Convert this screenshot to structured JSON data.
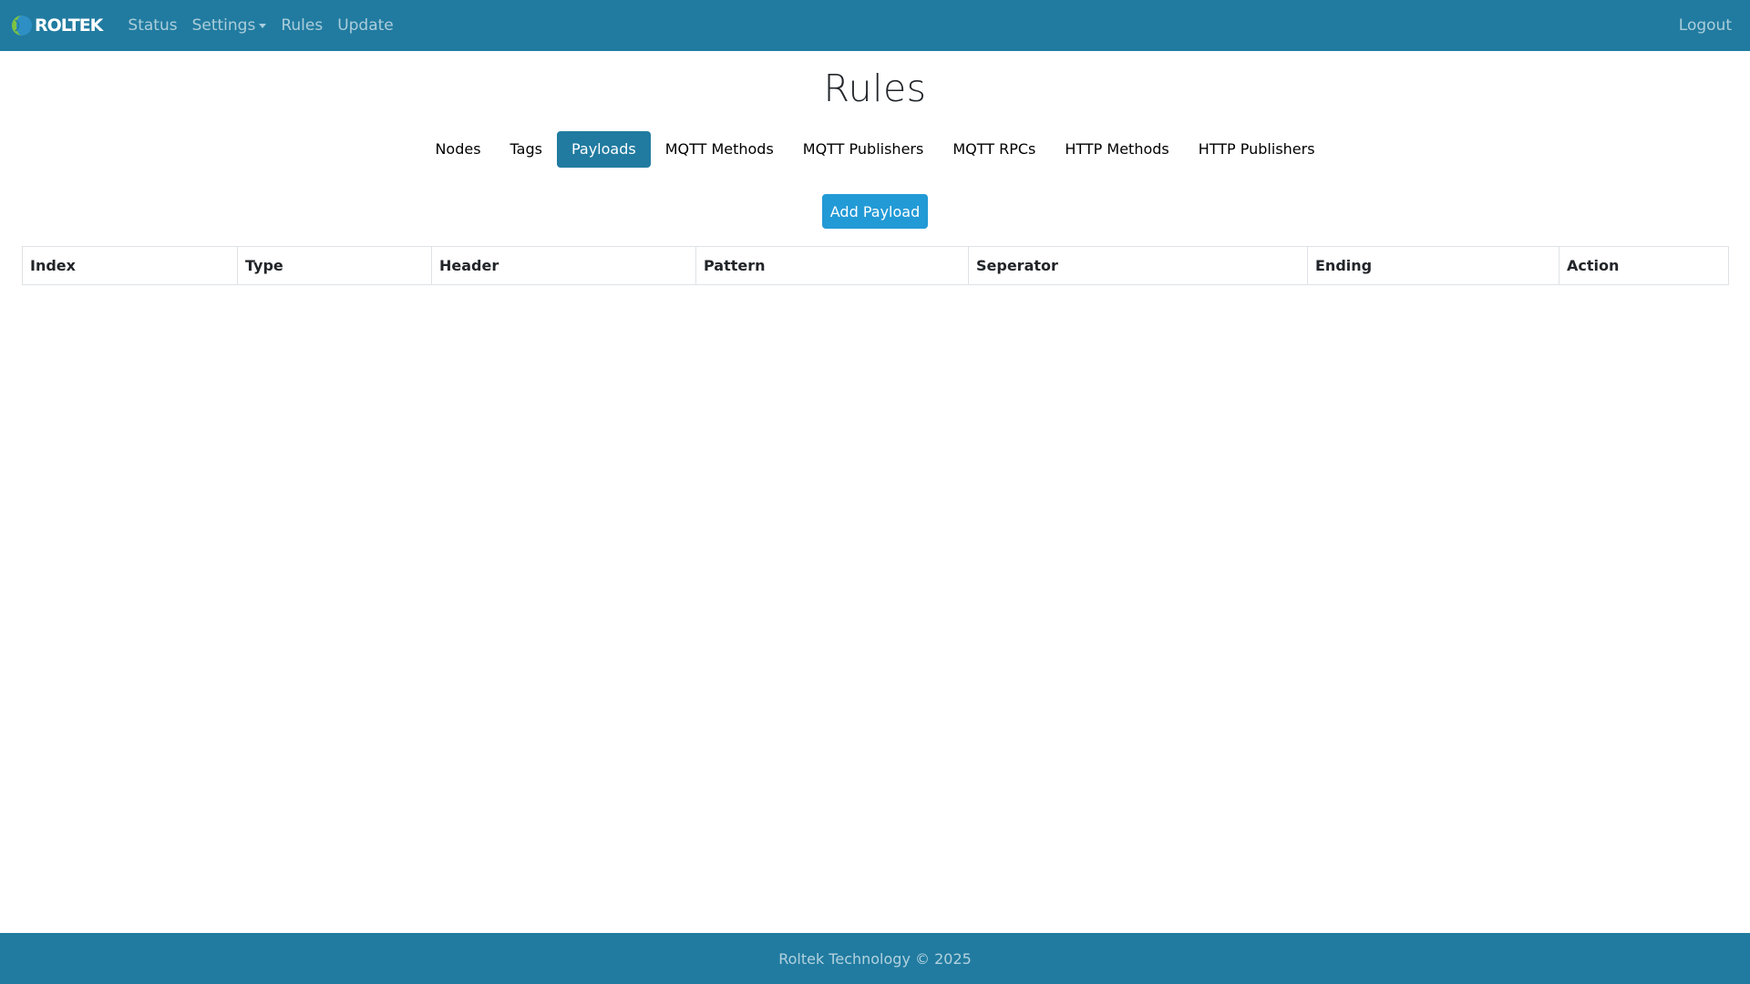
{
  "navbar": {
    "brand": "ROLTEK",
    "links": [
      "Status",
      "Settings",
      "Rules",
      "Update"
    ],
    "logout": "Logout",
    "colors": {
      "background": "#217ba0"
    }
  },
  "page": {
    "title": "Rules"
  },
  "tabs": [
    {
      "label": "Nodes",
      "active": false
    },
    {
      "label": "Tags",
      "active": false
    },
    {
      "label": "Payloads",
      "active": true
    },
    {
      "label": "MQTT Methods",
      "active": false
    },
    {
      "label": "MQTT Publishers",
      "active": false
    },
    {
      "label": "MQTT RPCs",
      "active": false
    },
    {
      "label": "HTTP Methods",
      "active": false
    },
    {
      "label": "HTTP Publishers",
      "active": false
    }
  ],
  "actions": {
    "add_label": "Add Payload"
  },
  "table": {
    "columns": [
      "Index",
      "Type",
      "Header",
      "Pattern",
      "Seperator",
      "Ending",
      "Action"
    ],
    "rows": []
  },
  "footer": {
    "text": "Roltek Technology © 2025"
  },
  "colors": {
    "primary": "#217ba0",
    "button": "#229ad6"
  }
}
